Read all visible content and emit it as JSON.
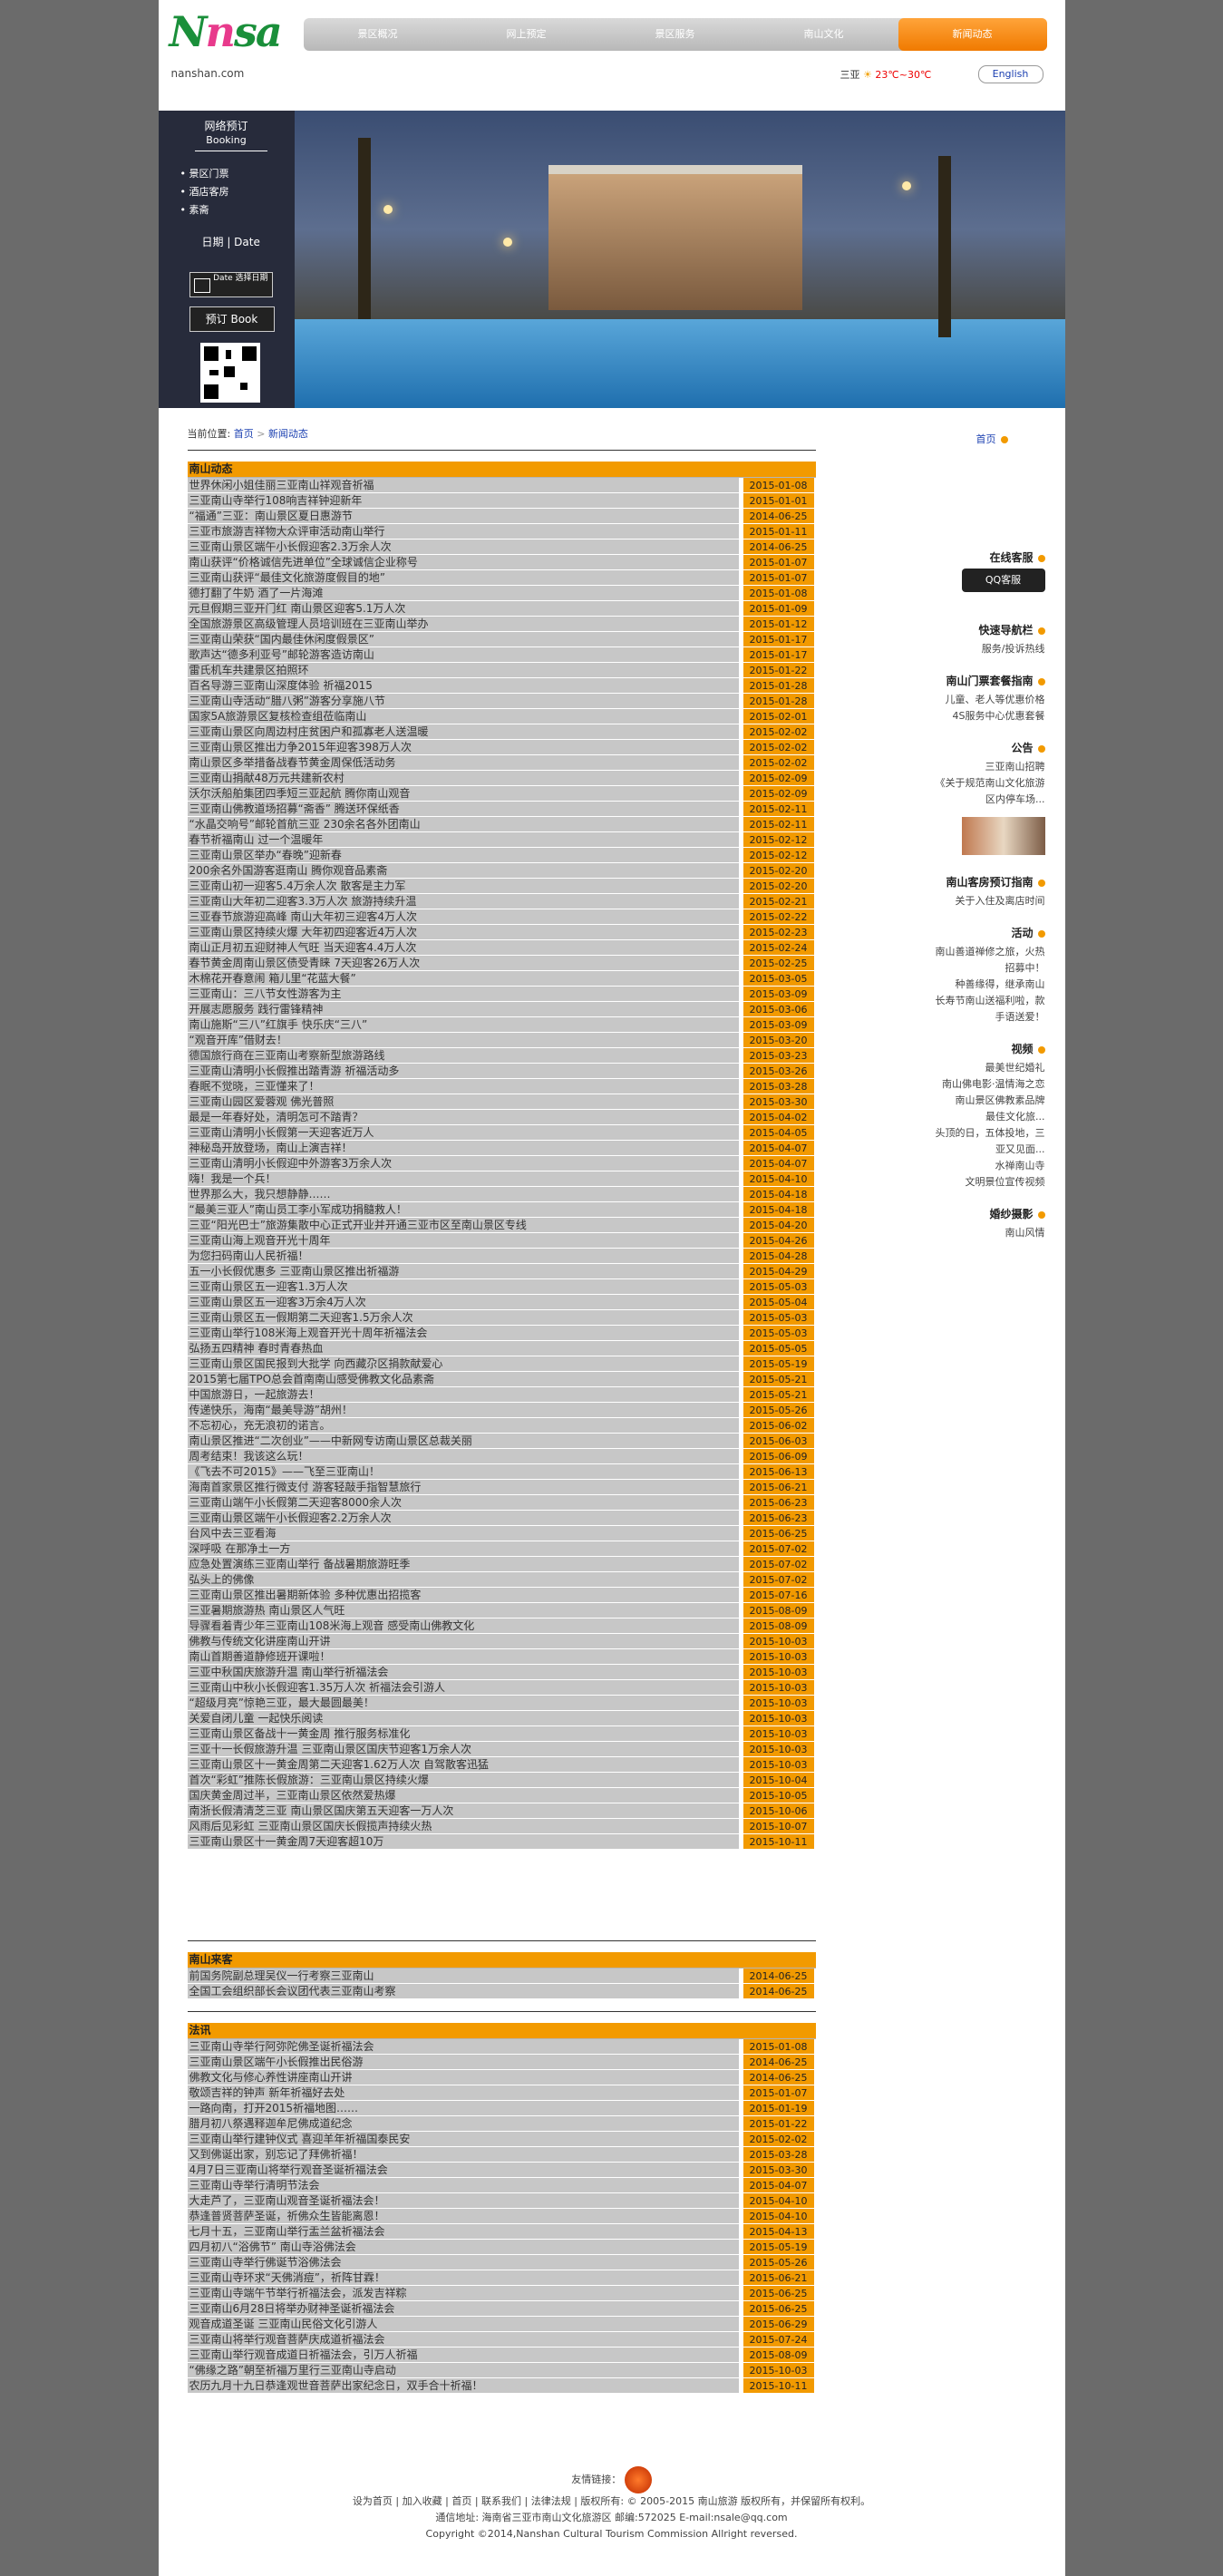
{
  "header": {
    "logo_text": "Nnsa",
    "site": "nanshan.com",
    "nav": [
      "景区概况",
      "网上预定",
      "景区服务",
      "南山文化",
      "新闻动态"
    ],
    "weather_city": "三亚",
    "weather_range": "23℃~30℃",
    "lang": "English"
  },
  "booking": {
    "title": "网络预订",
    "title_en": "Booking",
    "items": [
      "景区门票",
      "酒店客房",
      "素斋"
    ],
    "date_label": "日期 | Date",
    "date_button": "Date 选择日期",
    "book_button": "预订  Book"
  },
  "breadcrumb": {
    "label": "当前位置:",
    "home": "首页",
    "current": "新闻动态"
  },
  "side_home": "首页",
  "news": {
    "title": "南山动态",
    "rows": [
      [
        "世界休闲小姐佳丽三亚南山祥观音祈福",
        "2015-01-08"
      ],
      [
        "三亚南山寺举行108响吉祥钟迎新年",
        "2015-01-01"
      ],
      [
        "“福通”三亚：南山景区夏日惠游节",
        "2014-06-25"
      ],
      [
        "三亚市旅游吉祥物大众评审活动南山举行",
        "2015-01-11"
      ],
      [
        "三亚南山景区端午小长假迎客2.3万余人次",
        "2014-06-25"
      ],
      [
        "南山获评“价格诚信先进单位”全球诚信企业称号",
        "2015-01-07"
      ],
      [
        "三亚南山获评“最佳文化旅游度假目的地”",
        "2015-01-07"
      ],
      [
        "德打翻了牛奶 酒了一片海滩",
        "2015-01-08"
      ],
      [
        "元旦假期三亚开门红 南山景区迎客5.1万人次",
        "2015-01-09"
      ],
      [
        "全国旅游景区高级管理人员培训班在三亚南山举办",
        "2015-01-12"
      ],
      [
        "三亚南山荣获“国内最佳休闲度假景区”",
        "2015-01-17"
      ],
      [
        "歌声达“德多利亚号”邮轮游客造访南山",
        "2015-01-17"
      ],
      [
        "雷氏机车共建景区拍照环",
        "2015-01-22"
      ],
      [
        "百名导游三亚南山深度体验 祈福2015",
        "2015-01-28"
      ],
      [
        "三亚南山寺活动“腊八粥”游客分享施八节",
        "2015-01-28"
      ],
      [
        "国家5A旅游景区复核检查组莅临南山",
        "2015-02-01"
      ],
      [
        "三亚南山景区向周边村庄贫困户和孤寡老人送温暖",
        "2015-02-02"
      ],
      [
        "三亚南山景区推出力争2015年迎客398万人次",
        "2015-02-02"
      ],
      [
        "南山景区多举措备战春节黄金周保低活动务",
        "2015-02-02"
      ],
      [
        "三亚南山捐献48万元共建新农村",
        "2015-02-09"
      ],
      [
        "沃尔沃船舶集团四季短三亚起航 腾你南山观音",
        "2015-02-09"
      ],
      [
        "三亚南山佛教道场招募“斋香” 腾送环保纸香",
        "2015-02-11"
      ],
      [
        "“水晶交响号”邮轮首航三亚 230余名各外团南山",
        "2015-02-11"
      ],
      [
        "春节祈福南山 过一个温暖年",
        "2015-02-12"
      ],
      [
        "三亚南山景区举办“春晚”迎新春",
        "2015-02-12"
      ],
      [
        "200余名外国游客逛南山 腾你观音品素斋",
        "2015-02-20"
      ],
      [
        "三亚南山初一迎客5.4万余人次 散客是主力军",
        "2015-02-20"
      ],
      [
        "三亚南山大年初二迎客3.3万人次 旅游持续升温",
        "2015-02-21"
      ],
      [
        "三亚春节旅游迎高峰 南山大年初三迎客4万人次",
        "2015-02-22"
      ],
      [
        "三亚南山景区持续火爆 大年初四迎客近4万人次",
        "2015-02-23"
      ],
      [
        "南山正月初五迎财神人气旺 当天迎客4.4万人次",
        "2015-02-24"
      ],
      [
        "春节黄金周南山景区债受青睐 7天迎客26万人次",
        "2015-02-25"
      ],
      [
        "木棉花开春意闹 箱儿里“花蓝大餐”",
        "2015-03-05"
      ],
      [
        "三亚南山：三八节女性游客为主",
        "2015-03-09"
      ],
      [
        "开展志愿服务 践行雷锋精神",
        "2015-03-06"
      ],
      [
        "南山施斯“三八”红旗手 快乐庆“三八”",
        "2015-03-09"
      ],
      [
        "“观音开库”借财去！",
        "2015-03-20"
      ],
      [
        "德国旅行商在三亚南山考察新型旅游路线",
        "2015-03-23"
      ],
      [
        "三亚南山清明小长假推出踏青游 祈福活动多",
        "2015-03-26"
      ],
      [
        "春眠不觉晓，三亚懂来了！",
        "2015-03-28"
      ],
      [
        "三亚南山园区爱蓉观 佛光普照",
        "2015-03-30"
      ],
      [
        "最是一年春好处，清明怎可不踏青？",
        "2015-04-02"
      ],
      [
        "三亚南山清明小长假第一天迎客近万人",
        "2015-04-05"
      ],
      [
        "神秘岛开放登场，南山上演吉祥！",
        "2015-04-07"
      ],
      [
        "三亚南山清明小长假迎中外游客3万余人次",
        "2015-04-07"
      ],
      [
        "嗨！我是一个兵！",
        "2015-04-10"
      ],
      [
        "世界那么大，我只想静静……",
        "2015-04-18"
      ],
      [
        "“最美三亚人”南山员工李小军成功捐髓救人！",
        "2015-04-18"
      ],
      [
        "三亚“阳光巴士”旅游集散中心正式开业并开通三亚市区至南山景区专线",
        "2015-04-20"
      ],
      [
        "三亚南山海上观音开光十周年",
        "2015-04-26"
      ],
      [
        "为您扫码南山人民祈福！",
        "2015-04-28"
      ],
      [
        "五一小长假优惠多 三亚南山景区推出祈福游",
        "2015-04-29"
      ],
      [
        "三亚南山景区五一迎客1.3万人次",
        "2015-05-03"
      ],
      [
        "三亚南山景区五一迎客3万余4万人次",
        "2015-05-04"
      ],
      [
        "三亚南山景区五一假期第二天迎客1.5万余人次",
        "2015-05-03"
      ],
      [
        "三亚南山举行108米海上观音开光十周年祈福法会",
        "2015-05-03"
      ],
      [
        "弘扬五四精神 春时青春热血",
        "2015-05-05"
      ],
      [
        "三亚南山景区国民报到大批学 向西藏尕区捐款献爱心",
        "2015-05-19"
      ],
      [
        "2015第七届TPO总会首南南山感受佛教文化品素斋",
        "2015-05-21"
      ],
      [
        "中国旅游日，一起旅游去！",
        "2015-05-21"
      ],
      [
        "传递快乐，海南“最美导游”胡州！",
        "2015-05-26"
      ],
      [
        "不忘初心，充无浪初的诺言。",
        "2015-06-02"
      ],
      [
        "南山景区推进“二次创业”——中新网专访南山景区总裁关丽",
        "2015-06-03"
      ],
      [
        "周考结束！我该这么玩！",
        "2015-06-09"
      ],
      [
        "《飞去不可2015》——飞至三亚南山！",
        "2015-06-13"
      ],
      [
        "海南首家景区推行微支付 游客轻敲手指智慧旅行",
        "2015-06-21"
      ],
      [
        "三亚南山端午小长假第二天迎客8000余人次",
        "2015-06-23"
      ],
      [
        "三亚南山景区端午小长假迎客2.2万余人次",
        "2015-06-23"
      ],
      [
        "台风中去三亚看海",
        "2015-06-25"
      ],
      [
        "深呼吸 在那净土一方",
        "2015-07-02"
      ],
      [
        "应急处置演练三亚南山举行 备战暑期旅游旺季",
        "2015-07-02"
      ],
      [
        "弘头上的佛像",
        "2015-07-02"
      ],
      [
        "三亚南山景区推出暑期新体验 多种优惠出招揽客",
        "2015-07-16"
      ],
      [
        "三亚暑期旅游热 南山景区人气旺",
        "2015-08-09"
      ],
      [
        "导骤看着青少年三亚南山108米海上观音 感受南山佛教文化",
        "2015-08-09"
      ],
      [
        "佛教与传统文化讲座南山开讲",
        "2015-10-03"
      ],
      [
        "南山首期善道静修班开课啦！",
        "2015-10-03"
      ],
      [
        "三亚中秋国庆旅游升温 南山举行祈福法会",
        "2015-10-03"
      ],
      [
        "三亚南山中秋小长假迎客1.35万人次 祈福法会引游人",
        "2015-10-03"
      ],
      [
        "“超级月亮”惊艳三亚，最大最圆最美！",
        "2015-10-03"
      ],
      [
        "关爱自闭儿童 一起快乐阅读",
        "2015-10-03"
      ],
      [
        "三亚南山景区备战十一黄金周 推行服务标准化",
        "2015-10-03"
      ],
      [
        "三亚十一长假旅游升温 三亚南山景区国庆节迎客1万余人次",
        "2015-10-03"
      ],
      [
        "三亚南山景区十一黄金周第二天迎客1.62万人次 自驾散客迅猛",
        "2015-10-03"
      ],
      [
        "首次“彩虹”推陈长假旅游：三亚南山景区持续火爆",
        "2015-10-04"
      ],
      [
        "国庆黄金周过半，三亚南山景区依然爱热爆",
        "2015-10-05"
      ],
      [
        "南浙长假清清芝三亚 南山景区国庆第五天迎客一万人次",
        "2015-10-06"
      ],
      [
        "风雨后见彩虹 三亚南山景区国庆长假揽声持续火热",
        "2015-10-07"
      ],
      [
        "三亚南山景区十一黄金周7天迎客超10万",
        "2015-10-11"
      ]
    ]
  },
  "guests": {
    "title": "南山来客",
    "rows": [
      [
        "前国务院副总理吴仪一行考察三亚南山",
        "2014-06-25"
      ],
      [
        "全国工会组织部长会议团代表三亚南山考察",
        "2014-06-25"
      ]
    ]
  },
  "dharma": {
    "title": "法讯",
    "rows": [
      [
        "三亚南山寺举行阿弥陀佛圣诞祈福法会",
        "2015-01-08"
      ],
      [
        "三亚南山景区端午小长假推出民俗游",
        "2014-06-25"
      ],
      [
        "佛教文化与修心养性讲座南山开讲",
        "2014-06-25"
      ],
      [
        "敬颂吉祥的钟声 新年祈福好去处",
        "2015-01-07"
      ],
      [
        "一路向南，打开2015祈福地图……",
        "2015-01-19"
      ],
      [
        "腊月初八祭遇释迦牟尼佛成道纪念",
        "2015-01-22"
      ],
      [
        "三亚南山举行建钟仪式 喜迎羊年祈福国泰民安",
        "2015-02-02"
      ],
      [
        "又到佛诞出家，别忘记了拜佛祈福！",
        "2015-03-28"
      ],
      [
        "4月7日三亚南山将举行观音圣诞祈福法会",
        "2015-03-30"
      ],
      [
        "三亚南山寺举行清明节法会",
        "2015-04-07"
      ],
      [
        "大走芦了，三亚南山观音圣诞祈福法会！",
        "2015-04-10"
      ],
      [
        "恭逢普贤菩萨圣诞，祈佛众生皆能离恩！",
        "2015-04-10"
      ],
      [
        "七月十五，三亚南山举行盂兰盆祈福法会",
        "2015-04-13"
      ],
      [
        "四月初八“浴佛节” 南山寺浴佛法会",
        "2015-05-19"
      ],
      [
        "三亚南山寺举行佛诞节浴佛法会",
        "2015-05-26"
      ],
      [
        "三亚南山寺环求“天佛消痘”，祈阵甘霖！",
        "2015-06-21"
      ],
      [
        "三亚南山寺端午节举行祈福法会，派发吉祥粽",
        "2015-06-25"
      ],
      [
        "三亚南山6月28日将举办财神圣诞祈福法会",
        "2015-06-25"
      ],
      [
        "观音成道圣诞 三亚南山民俗文化引游人",
        "2015-06-29"
      ],
      [
        "三亚南山将举行观音菩萨庆成道祈福法会",
        "2015-07-24"
      ],
      [
        "三亚南山举行观音成道日祈福法会，引万人祈福",
        "2015-08-09"
      ],
      [
        "“佛缘之路”朝至祈福万里行三亚南山寺启动",
        "2015-10-03"
      ],
      [
        "农历九月十九日恭逢观世音菩萨出家纪念日，双手合十祈福！",
        "2015-10-11"
      ]
    ]
  },
  "sidebar": {
    "online": "在线客服",
    "qq": "QQ客服",
    "quick": "快速导航栏",
    "quick_sub": "服务/投诉热线",
    "ticket": "南山门票套餐指南",
    "ticket_p1": "儿童、老人等优惠价格",
    "ticket_p2": "4S服务中心优惠套餐",
    "notice": "公告",
    "notice_p1": "三亚南山招聘",
    "notice_p2": "《关于规范南山文化旅游",
    "notice_p3": "区内停车场...",
    "hotel": "南山客房预订指南",
    "hotel_p": "关于入住及离店时间",
    "event": "活动",
    "event_p1": "南山善道禅修之旅，火热",
    "event_p2": "招募中！",
    "event_p3": "种善缘得，继承南山",
    "event_p4": "长寿节南山送福利啦，款",
    "event_p5": "手语送爱！",
    "video": "视频",
    "video_p1": "最美世纪婚礼",
    "video_p2": "南山佛电影·温情海之恋",
    "video_p3": "南山景区佛教素品牌",
    "video_p4": "最佳文化旅...",
    "video_p5": "头顶的日，五体投地，三",
    "video_p6": "亚又见面...",
    "video_p7": "水禅南山寺",
    "video_p8": "文明景位宣传视频",
    "wedding": "婚纱摄影",
    "wedding_p": "南山风情"
  },
  "footer": {
    "links_label": "友情链接：",
    "nav": "设为首页 | 加入收藏 | 首页 | 联系我们 | 法律法规 | 版权所有: © 2005-2015 南山旅游 版权所有，并保留所有权利。",
    "address": "通信地址: 海南省三亚市南山文化旅游区 邮编:572025 E-mail:nsale@qq.com",
    "copyright": "Copyright ©2014,Nanshan Cultural Tourism Commission Allright reversed."
  }
}
